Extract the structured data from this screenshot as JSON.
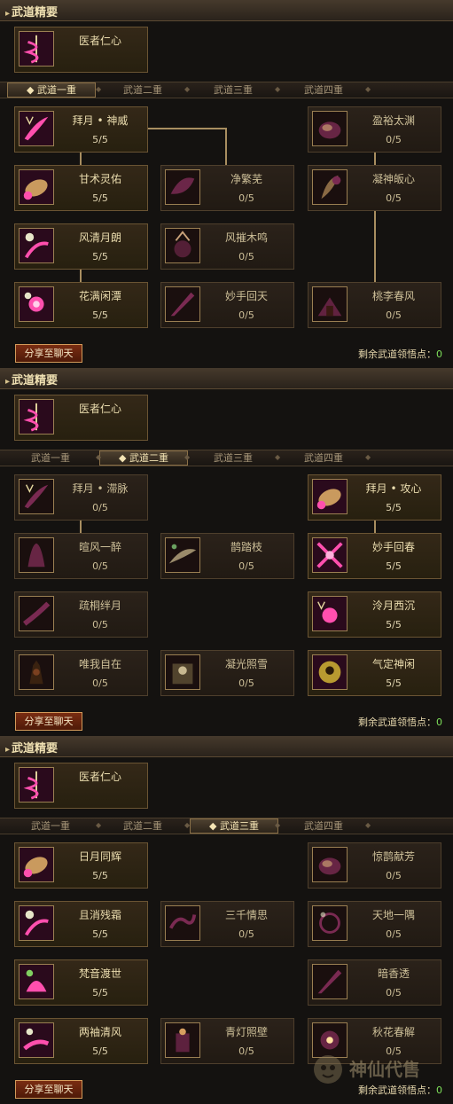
{
  "panels": [
    {
      "header": "武道精要",
      "essence": {
        "name": "医者仁心"
      },
      "tabs": [
        "武道一重",
        "武道二重",
        "武道三重",
        "武道四重"
      ],
      "active_tab": 0,
      "skills": [
        {
          "name": "拜月 • 神威",
          "level": "5/5",
          "icon": "moon-slash-icon",
          "lit": true
        },
        {
          "name": "盈裕太渊",
          "level": "0/5",
          "icon": "gourd-icon",
          "lit": false
        },
        {
          "name": "甘术灵佑",
          "level": "5/5",
          "icon": "seed-pod-icon",
          "lit": true
        },
        {
          "name": "净繁芜",
          "level": "0/5",
          "icon": "leaf-icon",
          "lit": false
        },
        {
          "name": "凝神皈心",
          "level": "0/5",
          "icon": "herb-icon",
          "lit": false
        },
        {
          "name": "风清月朗",
          "level": "5/5",
          "icon": "crescent-swirl-icon",
          "lit": true
        },
        {
          "name": "风摧木鸣",
          "level": "0/5",
          "icon": "spirit-icon",
          "lit": false
        },
        {
          "name": "花满闲潭",
          "level": "5/5",
          "icon": "blossom-burst-icon",
          "lit": true
        },
        {
          "name": "妙手回天",
          "level": "0/5",
          "icon": "blade-icon",
          "lit": false
        },
        {
          "name": "桃李春风",
          "level": "0/5",
          "icon": "temple-icon",
          "lit": false
        }
      ],
      "share_label": "分享至聊天",
      "points_label": "剩余武道领悟点：",
      "points_value": "0"
    },
    {
      "header": "武道精要",
      "essence": {
        "name": "医者仁心"
      },
      "tabs": [
        "武道一重",
        "武道二重",
        "武道三重",
        "武道四重"
      ],
      "active_tab": 1,
      "skills": [
        {
          "name": "拜月 • 滞脉",
          "level": "0/5",
          "icon": "moon-slash-icon",
          "lit": false
        },
        {
          "name": "拜月 • 攻心",
          "level": "5/5",
          "icon": "seed-pod-icon",
          "lit": true
        },
        {
          "name": "暄风一醉",
          "level": "0/5",
          "icon": "robe-icon",
          "lit": false
        },
        {
          "name": "鹊踏枝",
          "level": "0/5",
          "icon": "wing-icon",
          "lit": false
        },
        {
          "name": "妙手回春",
          "level": "5/5",
          "icon": "crossed-blades-icon",
          "lit": true
        },
        {
          "name": "疏桐绊月",
          "level": "0/5",
          "icon": "feather-icon",
          "lit": false
        },
        {
          "name": "泠月西沉",
          "level": "5/5",
          "icon": "moon-burst-icon",
          "lit": true
        },
        {
          "name": "唯我自在",
          "level": "0/5",
          "icon": "shadow-figure-icon",
          "lit": false
        },
        {
          "name": "凝光照雪",
          "level": "0/5",
          "icon": "snow-icon",
          "lit": false
        },
        {
          "name": "气定神闲",
          "level": "5/5",
          "icon": "golden-figure-icon",
          "lit": true
        }
      ],
      "share_label": "分享至聊天",
      "points_label": "剩余武道领悟点：",
      "points_value": "0"
    },
    {
      "header": "武道精要",
      "essence": {
        "name": "医者仁心"
      },
      "tabs": [
        "武道一重",
        "武道二重",
        "武道三重",
        "武道四重"
      ],
      "active_tab": 2,
      "skills": [
        {
          "name": "日月同辉",
          "level": "5/5",
          "icon": "seed-pod-icon",
          "lit": true
        },
        {
          "name": "惊鹊献芳",
          "level": "0/5",
          "icon": "gourd-icon",
          "lit": false
        },
        {
          "name": "且消残霜",
          "level": "5/5",
          "icon": "crescent-swirl-icon",
          "lit": true
        },
        {
          "name": "三千情思",
          "level": "0/5",
          "icon": "silk-icon",
          "lit": false
        },
        {
          "name": "天地一隅",
          "level": "0/5",
          "icon": "swirl-icon",
          "lit": false
        },
        {
          "name": "梵音渡世",
          "level": "5/5",
          "icon": "lotus-icon",
          "lit": true
        },
        {
          "name": "暗香透",
          "level": "0/5",
          "icon": "blade-icon",
          "lit": false
        },
        {
          "name": "两袖清风",
          "level": "5/5",
          "icon": "wind-sleeve-icon",
          "lit": true
        },
        {
          "name": "青灯照壁",
          "level": "0/5",
          "icon": "lamp-icon",
          "lit": false
        },
        {
          "name": "秋花春解",
          "level": "0/5",
          "icon": "flower-icon",
          "lit": false
        }
      ],
      "share_label": "分享至聊天",
      "points_label": "剩余武道领悟点：",
      "points_value": "0"
    }
  ],
  "watermark": "神仙代售",
  "colors": {
    "skill_glow": "#e0429a",
    "header_text": "#efe0b2",
    "points_value": "#7ee05a"
  }
}
